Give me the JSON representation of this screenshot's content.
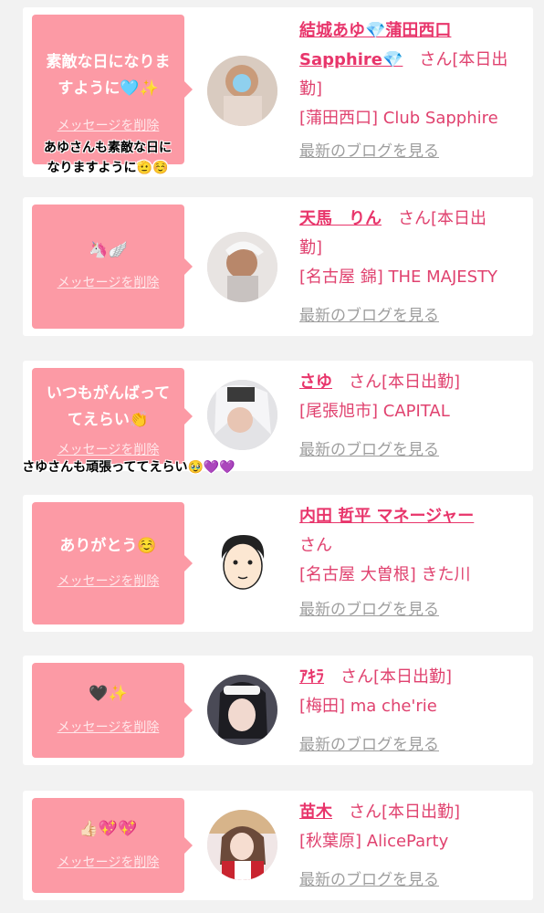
{
  "delete_label": "メッセージを削除",
  "blog_label": "最新のブログを見る",
  "cards": [
    {
      "message_lines": [
        "素敵な日になりま",
        "すように🩵✨"
      ],
      "name_lines": [
        "結城あゆ💎蒲田西口",
        "Sapphire💎"
      ],
      "suffix_lines": [
        "さん[本日出",
        "勤]"
      ],
      "shop": "[蒲田西口] Club Sapphire",
      "note_lines": [
        "あゆさんも素敵な日に",
        "なりますように🫡☺️"
      ]
    },
    {
      "message_lines": [
        "🦄🪽"
      ],
      "name_lines": [
        "天馬　りん"
      ],
      "suffix_lines": [
        "さん[本日出",
        "勤]"
      ],
      "shop": "[名古屋 錦] THE MAJESTY"
    },
    {
      "message_lines": [
        "いつもがんばって",
        "てえらい👏"
      ],
      "name_lines": [
        "さゆ"
      ],
      "suffix_lines": [
        "さん[本日出勤]"
      ],
      "shop": "[尾張旭市] CAPITAL",
      "note_lines": [
        "さゆさんも頑張っててえらい🥹💜💜"
      ]
    },
    {
      "message_lines": [
        "ありがとう☺️"
      ],
      "name_lines": [
        "内田 哲平 マネージャー"
      ],
      "suffix_lines": [
        "さん"
      ],
      "shop": "[名古屋 大曽根] きた川"
    },
    {
      "message_lines": [
        "🖤✨"
      ],
      "name_lines": [
        "ｱｷﾗ"
      ],
      "suffix_lines": [
        "さん[本日出勤]"
      ],
      "shop": "[梅田] ma che'rie"
    },
    {
      "message_lines": [
        "👍🏻💖💖"
      ],
      "name_lines": [
        "苗木"
      ],
      "suffix_lines": [
        "さん[本日出勤]"
      ],
      "shop": "[秋葉原] AliceParty"
    }
  ],
  "colors": {
    "bubble": "#fc9aa5",
    "name": "#e8356b",
    "text": "#e0426f",
    "blog": "#9e9e9e",
    "background": "#f2f2f2"
  }
}
